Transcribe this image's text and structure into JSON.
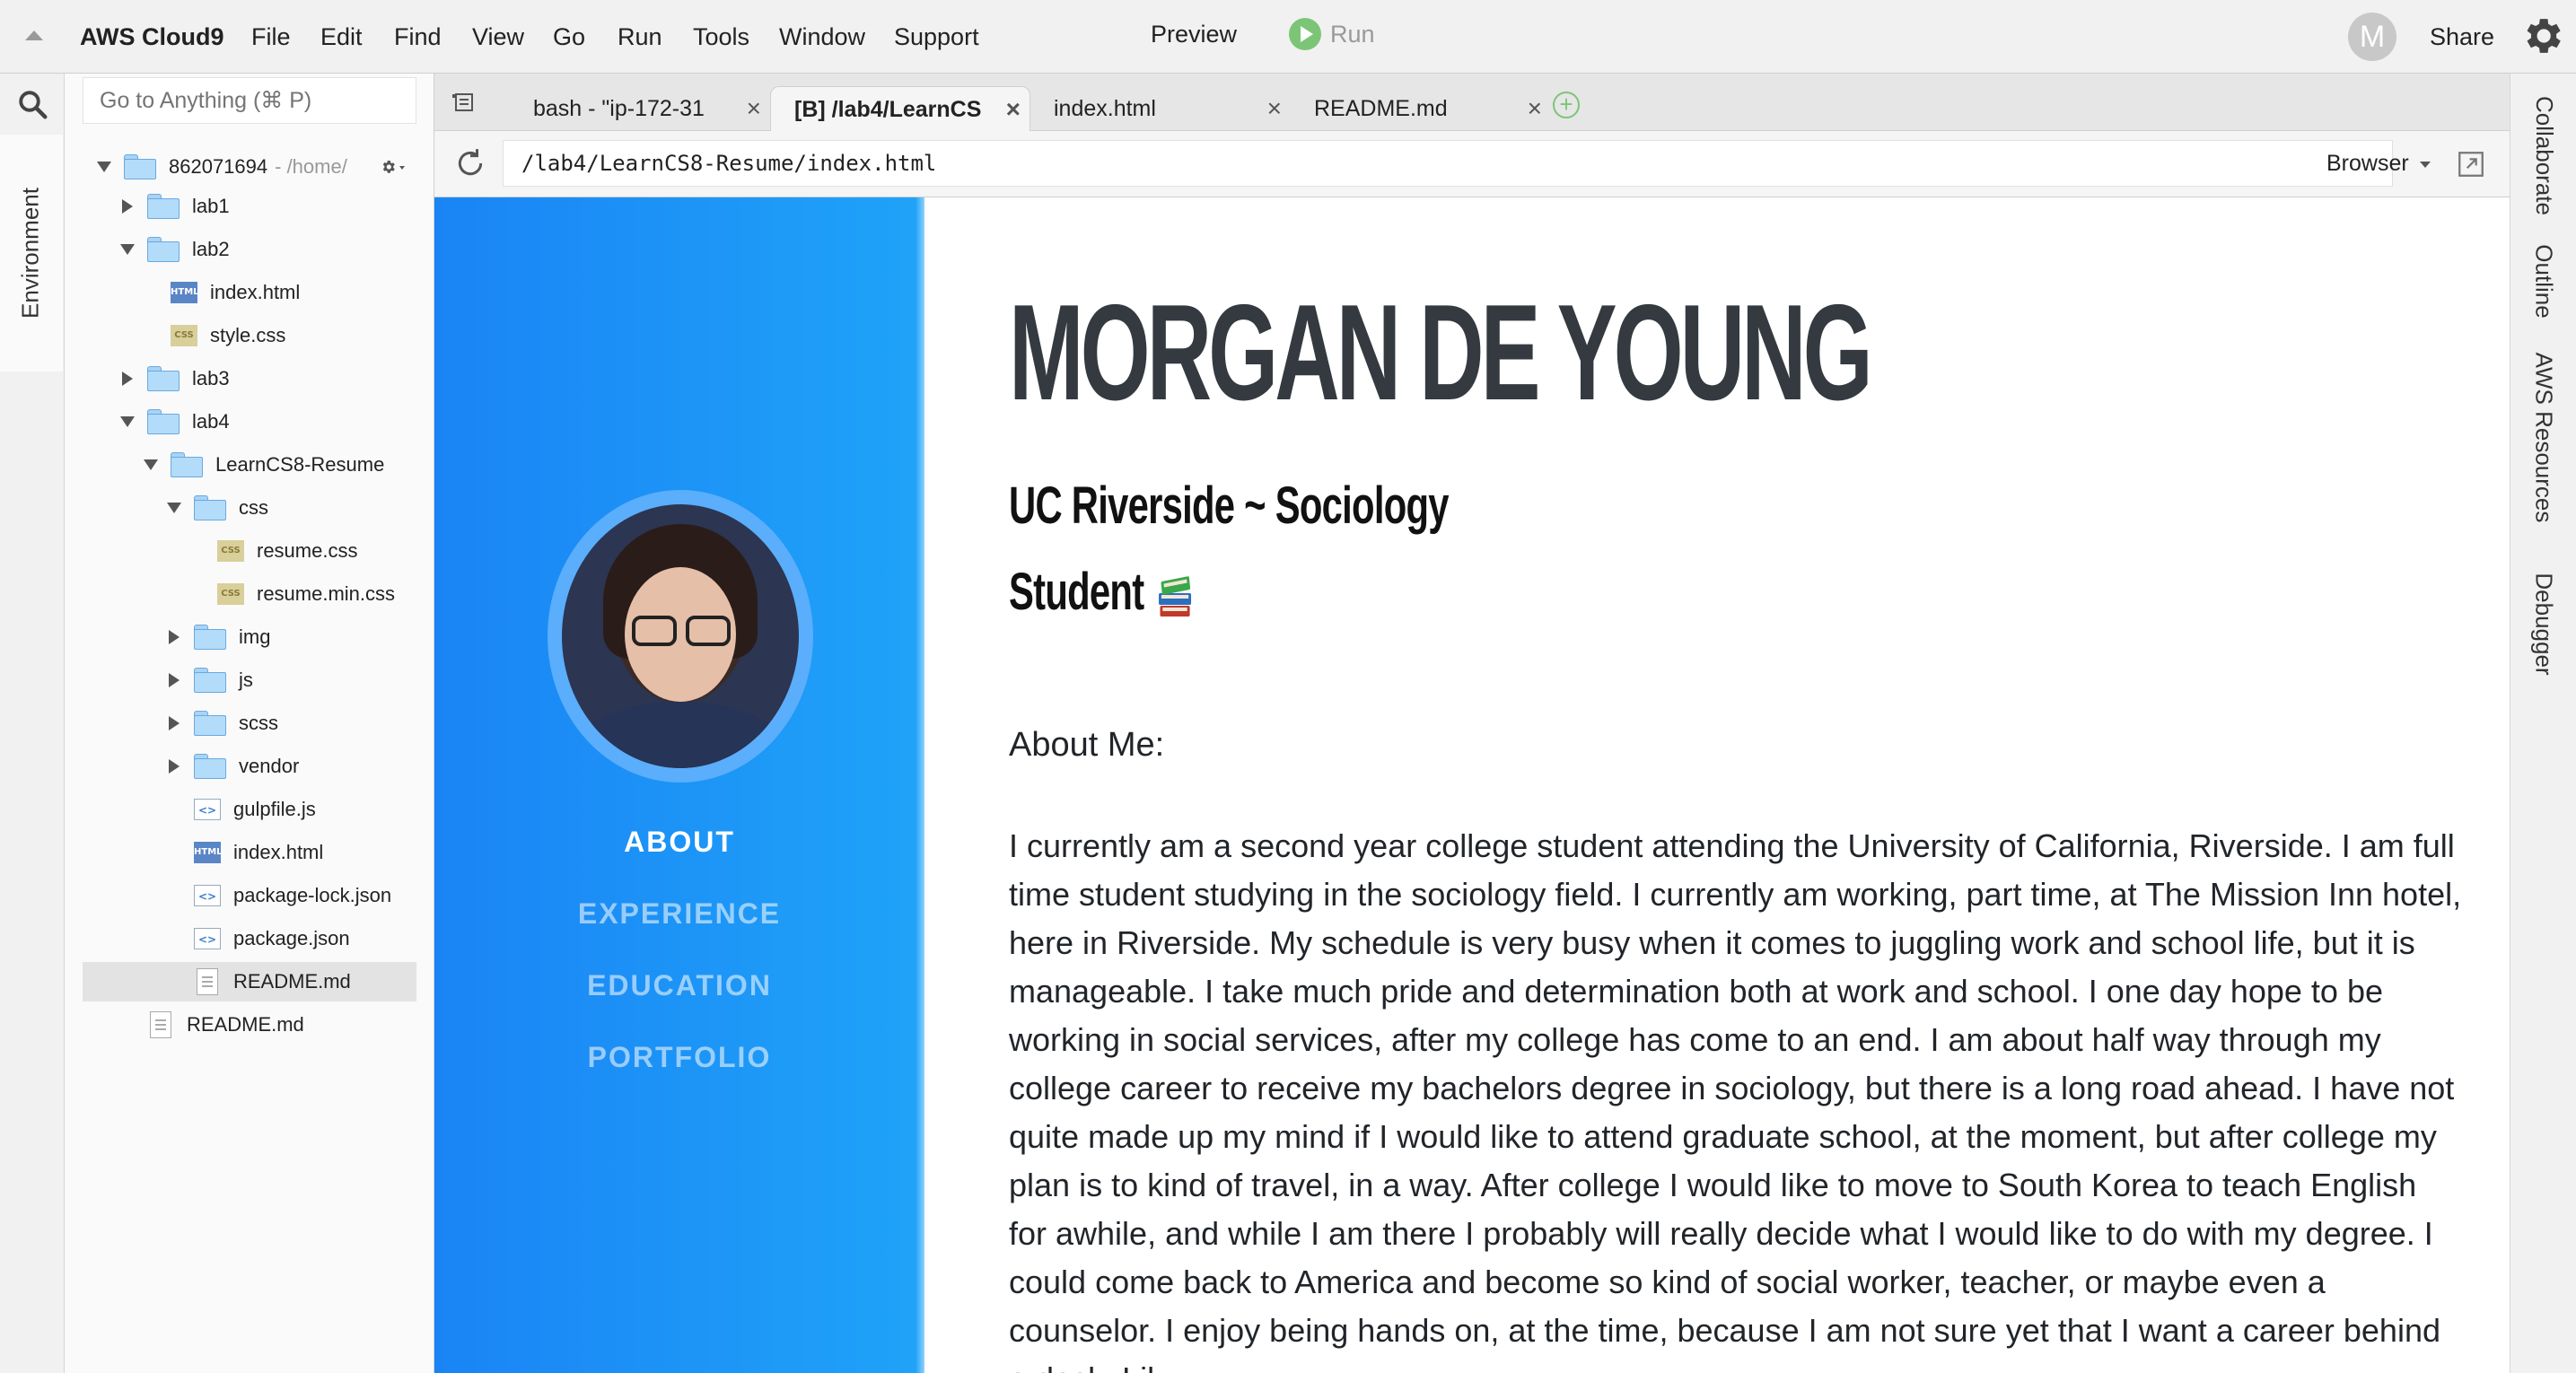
{
  "menubar": {
    "brand": "AWS Cloud9",
    "items": [
      "File",
      "Edit",
      "Find",
      "View",
      "Go",
      "Run",
      "Tools",
      "Window",
      "Support"
    ],
    "preview": "Preview",
    "run": "Run",
    "avatar_initial": "M",
    "share": "Share"
  },
  "left_rail": {
    "environment_tab": "Environment"
  },
  "tree": {
    "search_placeholder": "Go to Anything (⌘ P)",
    "root_name": "862071694",
    "root_path": "- /home/",
    "rows": [
      {
        "label": "lab1",
        "type": "folder",
        "state": "closed",
        "depth": 1
      },
      {
        "label": "lab2",
        "type": "folder",
        "state": "open",
        "depth": 1
      },
      {
        "label": "index.html",
        "type": "html",
        "depth": 2
      },
      {
        "label": "style.css",
        "type": "css",
        "depth": 2
      },
      {
        "label": "lab3",
        "type": "folder",
        "state": "closed",
        "depth": 1
      },
      {
        "label": "lab4",
        "type": "folder",
        "state": "open",
        "depth": 1
      },
      {
        "label": "LearnCS8-Resume",
        "type": "folder",
        "state": "open",
        "depth": 2
      },
      {
        "label": "css",
        "type": "folder",
        "state": "open",
        "depth": 3
      },
      {
        "label": "resume.css",
        "type": "css",
        "depth": 4
      },
      {
        "label": "resume.min.css",
        "type": "css",
        "depth": 4
      },
      {
        "label": "img",
        "type": "folder",
        "state": "closed",
        "depth": 3
      },
      {
        "label": "js",
        "type": "folder",
        "state": "closed",
        "depth": 3
      },
      {
        "label": "scss",
        "type": "folder",
        "state": "closed",
        "depth": 3
      },
      {
        "label": "vendor",
        "type": "folder",
        "state": "closed",
        "depth": 3
      },
      {
        "label": "gulpfile.js",
        "type": "js",
        "depth": 3
      },
      {
        "label": "index.html",
        "type": "html",
        "depth": 3
      },
      {
        "label": "package-lock.json",
        "type": "js",
        "depth": 3
      },
      {
        "label": "package.json",
        "type": "js",
        "depth": 3
      },
      {
        "label": "README.md",
        "type": "md",
        "depth": 3,
        "selected": true
      },
      {
        "label": "README.md",
        "type": "md",
        "depth": 1
      }
    ]
  },
  "right_rail": {
    "tabs": [
      "Collaborate",
      "Outline",
      "AWS Resources",
      "Debugger"
    ]
  },
  "tabs": [
    {
      "label": "bash - \"ip-172-31",
      "active": false
    },
    {
      "label": "[B] /lab4/LearnCS",
      "active": true
    },
    {
      "label": "index.html",
      "active": false
    },
    {
      "label": "README.md",
      "active": false
    }
  ],
  "addressbar": {
    "url": "/lab4/LearnCS8-Resume/index.html",
    "browser_select": "Browser"
  },
  "preview": {
    "nav": [
      "ABOUT",
      "EXPERIENCE",
      "EDUCATION",
      "PORTFOLIO"
    ],
    "name": "MORGAN DE YOUNG",
    "subtitle_line1": "UC Riverside ~ Sociology",
    "subtitle_line2": "Student",
    "about_label": "About Me:",
    "about_text": "I currently am a second year college student attending the University of California, Riverside. I am full time student studying in the sociology field. I currently am working, part time, at The Mission Inn hotel, here in Riverside. My schedule is very busy when it comes to juggling work and school life, but it is manageable. I take much pride and determination both at work and school. I one day hope to be working in social services, after my college has come to an end. I am about half way through my college career to receive my bachelors degree in sociology, but there is a long road ahead. I have not quite made up my mind if I would like to attend graduate school, at the moment, but after college my plan is to kind of travel, in a way. After college I would like to move to South Korea to teach English for awhile, and while I am there I probably will really decide what I would like to do with my degree. I could come back to America and become so kind of social worker, teacher, or maybe even a counselor. I enjoy being hands on, at the time, because I am not sure yet that I want a career behind a desk. Lik"
  },
  "colors": {
    "sidebar_gradient_start": "#1a84f5",
    "sidebar_gradient_end": "#1fa3f8",
    "run_green": "#7cc576",
    "name_color": "#343a40"
  }
}
